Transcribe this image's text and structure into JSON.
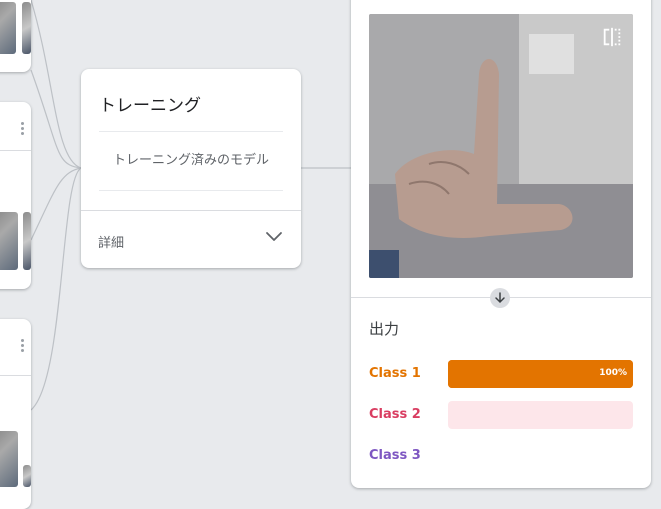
{
  "training": {
    "title": "トレーニング",
    "trained_model_button": "トレーニング済みのモデル",
    "details_label": "詳細",
    "details_icon": "chevron-down-icon"
  },
  "preview": {
    "crop_icon": "crop-icon",
    "flip_icon": "flip-horizontal-icon",
    "arrow_icon": "arrow-down-icon",
    "output_label": "出力",
    "classes": [
      {
        "name": "Class 1",
        "color": "#e37400",
        "track_color": "#e37400",
        "confidence": 1.0,
        "percent_label": "100%"
      },
      {
        "name": "Class 2",
        "color": "#d93d61",
        "track_color": "#fde6ea",
        "confidence": 0.0,
        "percent_label": ""
      },
      {
        "name": "Class 3",
        "color": "#7e57c2",
        "track_color": "#ffffff",
        "confidence": 0.0,
        "percent_label": ""
      }
    ]
  },
  "colors": {
    "background": "#e8eaed",
    "connector": "#bdc1c6",
    "divider": "#dadce0"
  }
}
